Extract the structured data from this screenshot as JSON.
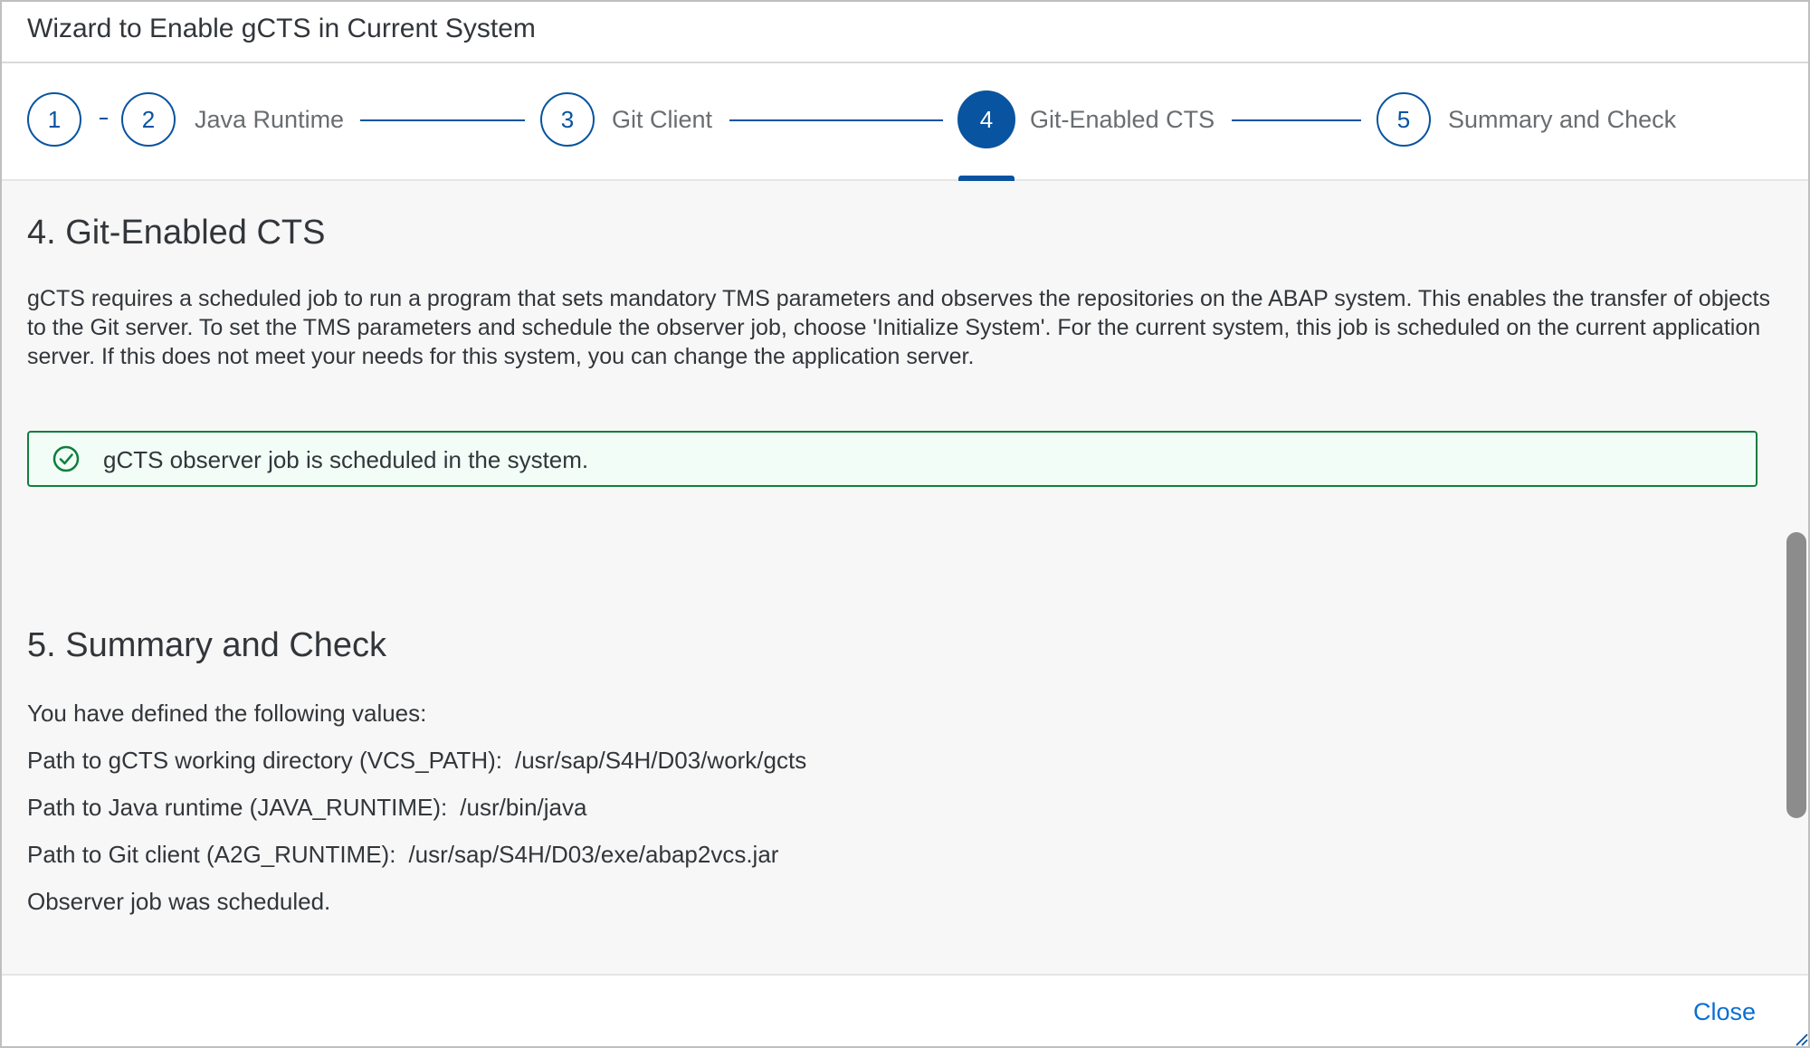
{
  "window": {
    "title": "Wizard to Enable gCTS in Current System"
  },
  "steps": [
    {
      "number": "1",
      "label": ""
    },
    {
      "number": "2",
      "label": "Java Runtime"
    },
    {
      "number": "3",
      "label": "Git Client"
    },
    {
      "number": "4",
      "label": "Git-Enabled CTS",
      "active": true
    },
    {
      "number": "5",
      "label": "Summary and Check"
    }
  ],
  "section4": {
    "title": "4. Git-Enabled CTS",
    "description": "gCTS requires a scheduled job to run a program that sets mandatory TMS parameters and observes the repositories on the ABAP system. This enables the transfer of objects to the Git server. To set the TMS parameters and schedule the observer job, choose 'Initialize System'. For the current system, this job is scheduled on the current application server. If this does not meet your needs for this system, you can change the application server.",
    "message": "gCTS observer job is scheduled in the system.",
    "message_icon": "success-check-icon"
  },
  "section5": {
    "title": "5. Summary and Check",
    "intro": "You have defined the following values:",
    "items": [
      {
        "label": "Path to gCTS working directory (VCS_PATH):",
        "value": "/usr/sap/S4H/D03/work/gcts"
      },
      {
        "label": "Path to Java runtime (JAVA_RUNTIME):",
        "value": "/usr/bin/java"
      },
      {
        "label": "Path to Git client (A2G_RUNTIME):",
        "value": "/usr/sap/S4H/D03/exe/abap2vcs.jar"
      }
    ],
    "footer_note": "Observer job was scheduled."
  },
  "footer": {
    "close_label": "Close"
  },
  "colors": {
    "accent": "#0854a0",
    "link": "#0a6ed1",
    "success": "#107e3e",
    "content_bg": "#f7f7f7"
  }
}
